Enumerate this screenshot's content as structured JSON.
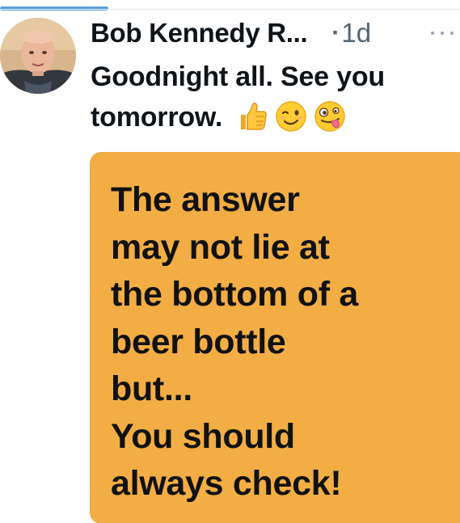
{
  "post": {
    "author_name": "Bob Kennedy R...",
    "separator": "·",
    "timestamp": "1d",
    "text": "Goodnight all. See you tomorrow.",
    "emojis": [
      "thumbs-up-icon",
      "winking-face-icon",
      "zany-face-icon"
    ],
    "more_icon": "more-options-icon"
  },
  "media": {
    "background_color": "#f2ad45",
    "lines": [
      "The answer",
      "may not lie at",
      "the bottom of a",
      "beer bottle",
      "but...",
      "You should",
      "always check!"
    ]
  },
  "colors": {
    "accent": "#5b9fd8",
    "primary_text": "#0f1419",
    "secondary_text": "#536471"
  }
}
